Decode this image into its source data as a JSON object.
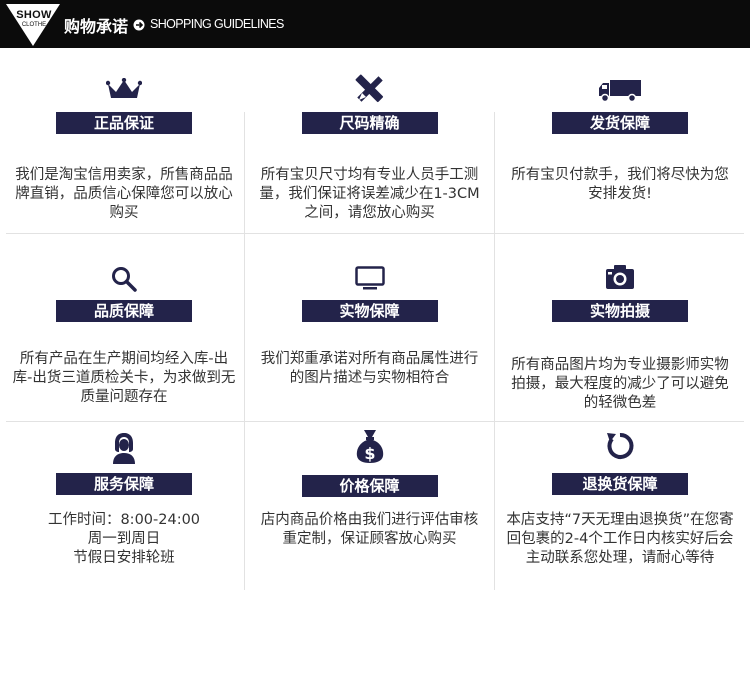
{
  "header": {
    "badge_top": "SHOW",
    "badge_bottom": "CLOTHE",
    "title": "购物承诺",
    "subtitle": "SHOPPING GUIDELINES"
  },
  "items": [
    {
      "icon": "crown-icon",
      "label": "正品保证",
      "desc": "我们是淘宝信用卖家，所售商品品牌直销，品质信心保障您可以放心购买"
    },
    {
      "icon": "ruler-pencil-icon",
      "label": "尺码精确",
      "desc": "所有宝贝尺寸均有专业人员手工测量，我们保证将误差减少在1-3CM之间，请您放心购买"
    },
    {
      "icon": "truck-icon",
      "label": "发货保障",
      "desc": "所有宝贝付款手，我们将尽快为您安排发货!"
    },
    {
      "icon": "search-icon",
      "label": "品质保障",
      "desc": "所有产品在生产期间均经入库-出库-出货三道质检关卡，为求做到无质量问题存在"
    },
    {
      "icon": "monitor-icon",
      "label": "实物保障",
      "desc": "我们郑重承诺对所有商品属性进行的图片描述与实物相符合"
    },
    {
      "icon": "camera-icon",
      "label": "实物拍摄",
      "desc": "所有商品图片均为专业摄影师实物拍摄，最大程度的减少了可以避免的轻微色差"
    },
    {
      "icon": "customer-service-icon",
      "label": "服务保障",
      "desc": "工作时间：8:00-24:00\n周一到周日\n节假日安排轮班"
    },
    {
      "icon": "money-bag-icon",
      "label": "价格保障",
      "desc": "店内商品价格由我们进行评估审核重定制，保证顾客放心购买"
    },
    {
      "icon": "refresh-icon",
      "label": "退换货保障",
      "desc": "本店支持“7天无理由退换货”在您寄回包裹的2-4个工作日内核实好后会主动联系您处理，请耐心等待"
    }
  ]
}
